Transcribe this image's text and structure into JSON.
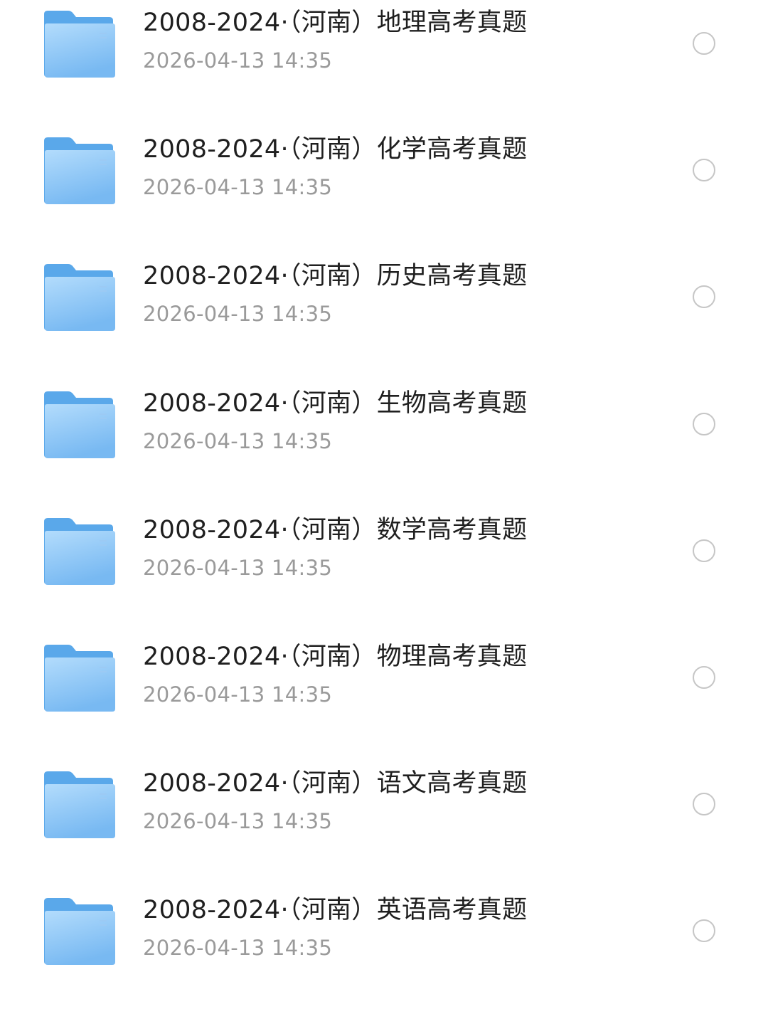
{
  "file_list": {
    "items": [
      {
        "name": "2008-2024·（河南）地理高考真题",
        "modified": "2026-04-13 14:35",
        "icon": "folder-icon",
        "selected": false
      },
      {
        "name": "2008-2024·（河南）化学高考真题",
        "modified": "2026-04-13 14:35",
        "icon": "folder-icon",
        "selected": false
      },
      {
        "name": "2008-2024·（河南）历史高考真题",
        "modified": "2026-04-13 14:35",
        "icon": "folder-icon",
        "selected": false
      },
      {
        "name": "2008-2024·（河南）生物高考真题",
        "modified": "2026-04-13 14:35",
        "icon": "folder-icon",
        "selected": false
      },
      {
        "name": "2008-2024·（河南）数学高考真题",
        "modified": "2026-04-13 14:35",
        "icon": "folder-icon",
        "selected": false
      },
      {
        "name": "2008-2024·（河南）物理高考真题",
        "modified": "2026-04-13 14:35",
        "icon": "folder-icon",
        "selected": false
      },
      {
        "name": "2008-2024·（河南）语文高考真题",
        "modified": "2026-04-13 14:35",
        "icon": "folder-icon",
        "selected": false
      },
      {
        "name": "2008-2024·（河南）英语高考真题",
        "modified": "2026-04-13 14:35",
        "icon": "folder-icon",
        "selected": false
      }
    ]
  },
  "colors": {
    "folder_back": "#5aa8ea",
    "folder_front_top": "#a9d6fb",
    "folder_front_bottom": "#7cbcf3",
    "title_text": "#1f1f1f",
    "date_text": "#9a9a9a",
    "checkbox_border": "#c6c6c6"
  }
}
